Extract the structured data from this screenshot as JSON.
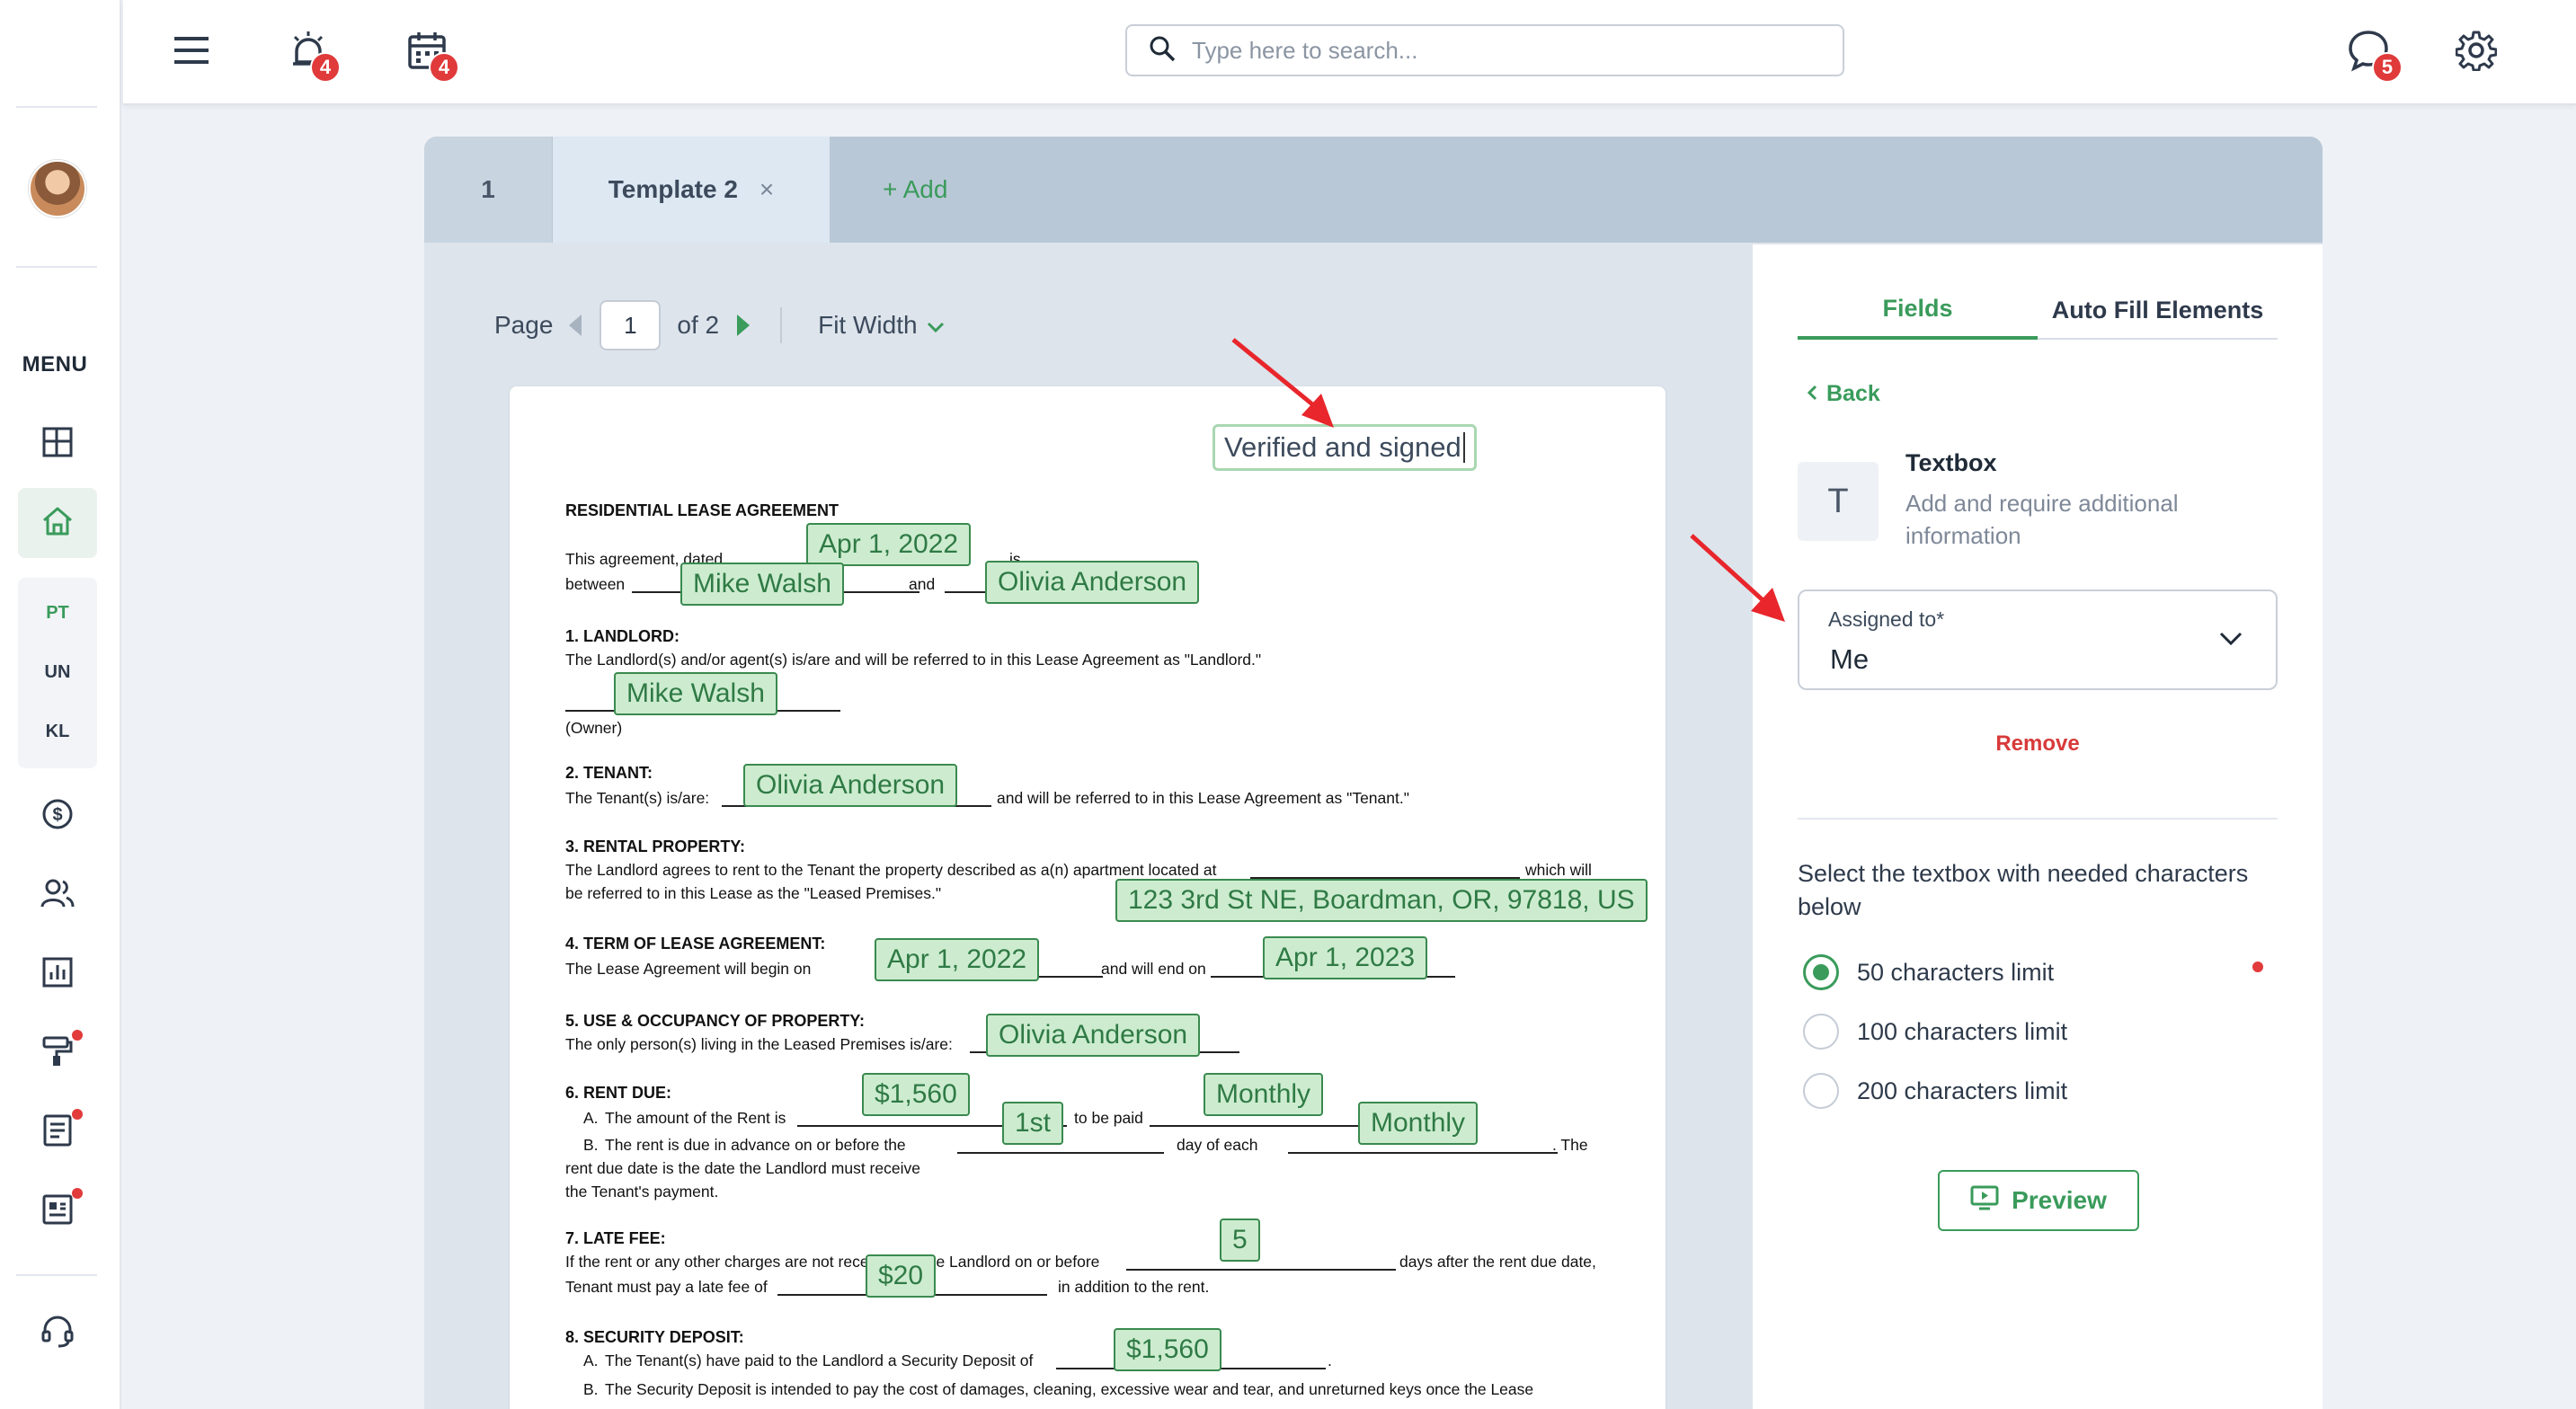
{
  "sidebar": {
    "menu_label": "MENU",
    "sub_items": [
      "PT",
      "UN",
      "KL"
    ],
    "icons": [
      "dashboard-icon",
      "home-icon",
      "dollar-icon",
      "contacts-icon",
      "reports-icon",
      "paint-roller-icon",
      "document-icon",
      "newspaper-icon",
      "support-icon"
    ]
  },
  "header": {
    "search_placeholder": "Type here to search...",
    "alarm_count": "4",
    "calendar_count": "4",
    "chat_count": "5"
  },
  "tabs": [
    {
      "label": "1"
    },
    {
      "label": "Template 2",
      "close": "×"
    },
    {
      "label": "+ Add"
    }
  ],
  "pager": {
    "page_label": "Page",
    "current": "1",
    "of_label": "of 2",
    "zoom": "Fit Width"
  },
  "document": {
    "title": "RESIDENTIAL LEASE AGREEMENT",
    "intro_1": "This agreement, dated",
    "intro_is": "is",
    "intro_between": "between",
    "intro_and": "and",
    "s1_head": "1. LANDLORD:",
    "s1_text": "The Landlord(s) and/or agent(s) is/are and will be referred to in this Lease Agreement as \"Landlord.\"",
    "s1_owner": "(Owner)",
    "s2_head": "2. TENANT:",
    "s2_text_a": "The Tenant(s) is/are:",
    "s2_text_b": "and will be referred to in this Lease Agreement as \"Tenant.\"",
    "s3_head": "3. RENTAL PROPERTY:",
    "s3_text_a": "The Landlord agrees to rent to the Tenant the property described as a(n) apartment located at",
    "s3_text_b": "which will",
    "s3_text_c": "be referred to in this Lease as the \"Leased Premises.\"",
    "s4_head": "4. TERM OF LEASE AGREEMENT:",
    "s4_text_a": "The Lease Agreement will begin on",
    "s4_text_b": "and will end on",
    "s5_head": "5. USE & OCCUPANCY OF PROPERTY:",
    "s5_text": "The only person(s) living in the Leased Premises is/are:",
    "s6_head": "6. RENT DUE:",
    "s6_a_1": "A.",
    "s6_a_2": "The amount of the Rent is",
    "s6_a_3": "to be paid",
    "s6_b_1": "B.",
    "s6_b_2": "The rent is due in advance on or before the",
    "s6_b_3": "day of each",
    "s6_b_4": ". The",
    "s6_b_5": "rent due date is the date the Landlord must receive",
    "s6_b_6": "the Tenant's payment.",
    "s7_head": "7. LATE FEE:",
    "s7_text_a": "If the rent or any other charges are not received by the Landlord on or before",
    "s7_text_b": "days after the rent due date,",
    "s7_text_c": "Tenant must pay a late fee of",
    "s7_text_d": "in addition to the rent.",
    "s8_head": "8. SECURITY DEPOSIT:",
    "s8_a_1": "A.",
    "s8_a_2": "The Tenant(s) have paid to the Landlord a Security Deposit of",
    "s8_b_1": "B.",
    "s8_b_2": "The Security Deposit is intended to pay the cost of damages, cleaning, excessive wear and tear, and unreturned keys once the Lease"
  },
  "fields": {
    "verified": "Verified and signed",
    "date_start": "Apr 1, 2022",
    "landlord": "Mike Walsh",
    "tenant": "Olivia Anderson",
    "landlord_2": "Mike Walsh",
    "tenant_2": "Olivia Anderson",
    "address": "123 3rd St NE, Boardman, OR, 97818, US",
    "term_start": "Apr 1, 2022",
    "term_end": "Apr 1, 2023",
    "occupant": "Olivia Anderson",
    "rent": "$1,560",
    "frequency": "Monthly",
    "due_day": "1st",
    "due_each": "Monthly",
    "late_days": "5",
    "late_fee": "$20",
    "deposit": "$1,560"
  },
  "side_panel": {
    "tab_fields": "Fields",
    "tab_autofill": "Auto Fill Elements",
    "back": "Back",
    "type_icon": "T",
    "type_title": "Textbox",
    "type_desc": "Add and require additional information",
    "assigned_label": "Assigned to*",
    "assigned_value": "Me",
    "remove": "Remove",
    "select_text": "Select the textbox with needed characters below",
    "options": [
      "50 characters limit",
      "100 characters limit",
      "200 characters limit"
    ],
    "selected_index": 0,
    "preview": "Preview"
  },
  "colors": {
    "accent": "#3a9b5b",
    "field_fill": "#cdeccf",
    "badge": "#e03a3a",
    "annotation_arrow": "#e8262b"
  }
}
